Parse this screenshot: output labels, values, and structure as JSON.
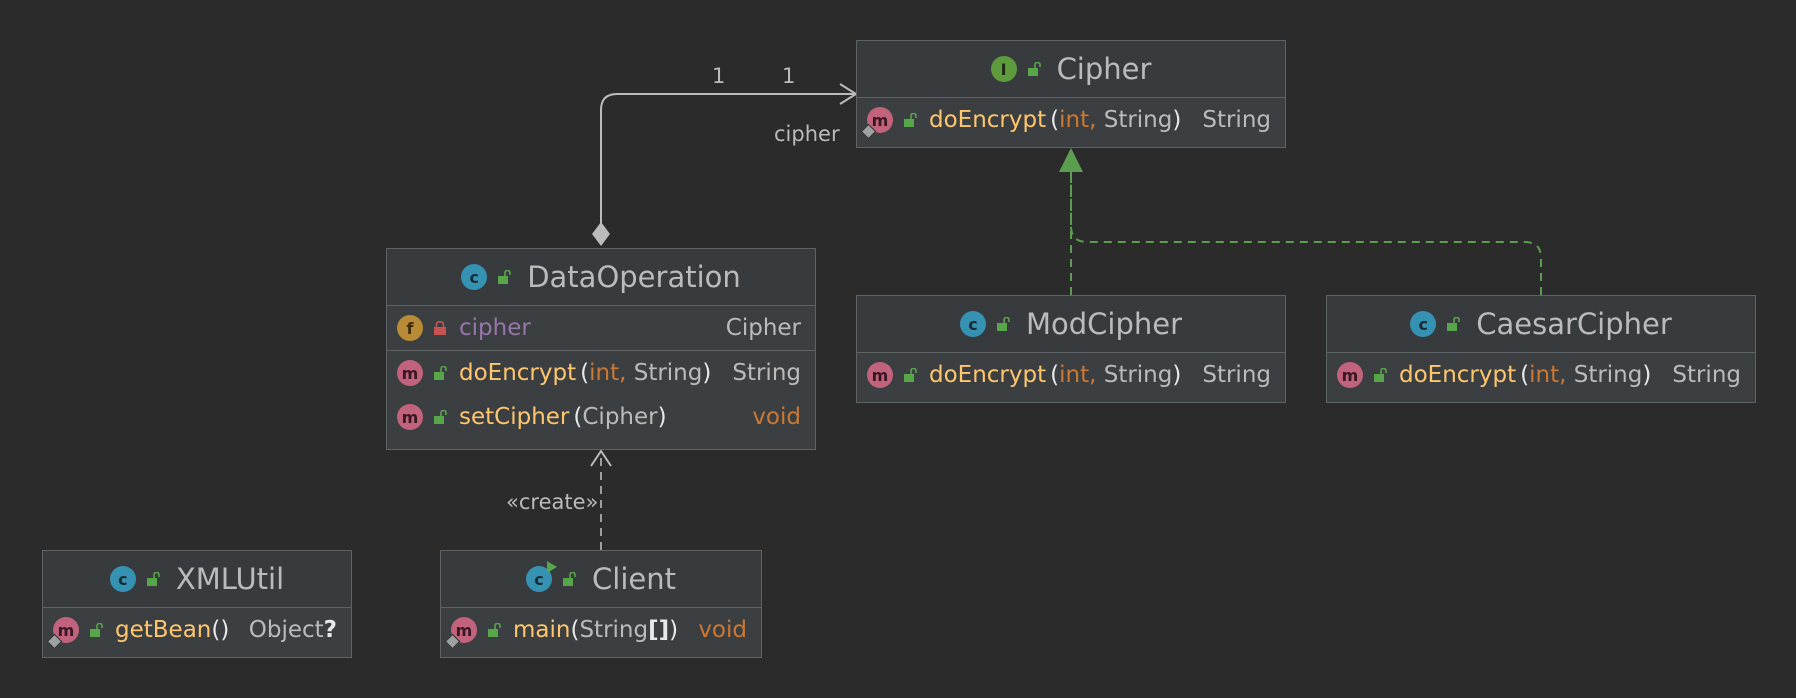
{
  "colors": {
    "background": "#2b2b2b",
    "box": "#3c3f41",
    "method": "#ffc66d",
    "field": "#9876aa",
    "keyword": "#cc7832",
    "edge_composition": "#bbbbbb",
    "edge_realization": "#5c9e4f",
    "edge_dependency": "#9e9e9e"
  },
  "icons": {
    "class": "class-icon",
    "interface": "interface-icon",
    "method": "method-icon",
    "field": "field-icon",
    "public": "unlocked-icon",
    "private": "locked-icon"
  },
  "classes": {
    "cipher": {
      "badge": "I",
      "name": "Cipher",
      "m1": {
        "badge": "m",
        "name": "doEncrypt",
        "open": "(",
        "p1": "int,",
        "p2": " String",
        "close": ")",
        "ret": "String"
      }
    },
    "data_operation": {
      "badge": "c",
      "name": "DataOperation",
      "f1": {
        "badge": "f",
        "name": "cipher",
        "type": "Cipher"
      },
      "m1": {
        "badge": "m",
        "name": "doEncrypt",
        "open": "(",
        "p1": "int,",
        "p2": " String",
        "close": ")",
        "ret": "String"
      },
      "m2": {
        "badge": "m",
        "name": "setCipher",
        "open": "(",
        "p1": "Cipher",
        "close": ")",
        "ret": "void"
      }
    },
    "mod_cipher": {
      "badge": "c",
      "name": "ModCipher",
      "m1": {
        "badge": "m",
        "name": "doEncrypt",
        "open": "(",
        "p1": "int,",
        "p2": " String",
        "close": ")",
        "ret": "String"
      }
    },
    "caesar_cipher": {
      "badge": "c",
      "name": "CaesarCipher",
      "m1": {
        "badge": "m",
        "name": "doEncrypt",
        "open": "(",
        "p1": "int,",
        "p2": " String",
        "close": ")",
        "ret": "String"
      }
    },
    "xml_util": {
      "badge": "c",
      "name": "XMLUtil",
      "m1": {
        "badge": "m",
        "name": "getBean",
        "open": "()",
        "ret": "Object",
        "ret_mark": "?"
      }
    },
    "client": {
      "badge": "c",
      "name": "Client",
      "m1": {
        "badge": "m",
        "name": "main",
        "open": "(",
        "p1": "String",
        "arr": "[]",
        "close": ")",
        "ret": "void"
      }
    }
  },
  "edges": {
    "composition": {
      "from": "DataOperation",
      "to": "Cipher",
      "mult_source": "1",
      "mult_target": "1",
      "role": "cipher"
    },
    "realization_mod": {
      "from": "ModCipher",
      "to": "Cipher"
    },
    "realization_caesar": {
      "from": "CaesarCipher",
      "to": "Cipher"
    },
    "create": {
      "from": "Client",
      "to": "DataOperation",
      "label": "«create»"
    }
  }
}
